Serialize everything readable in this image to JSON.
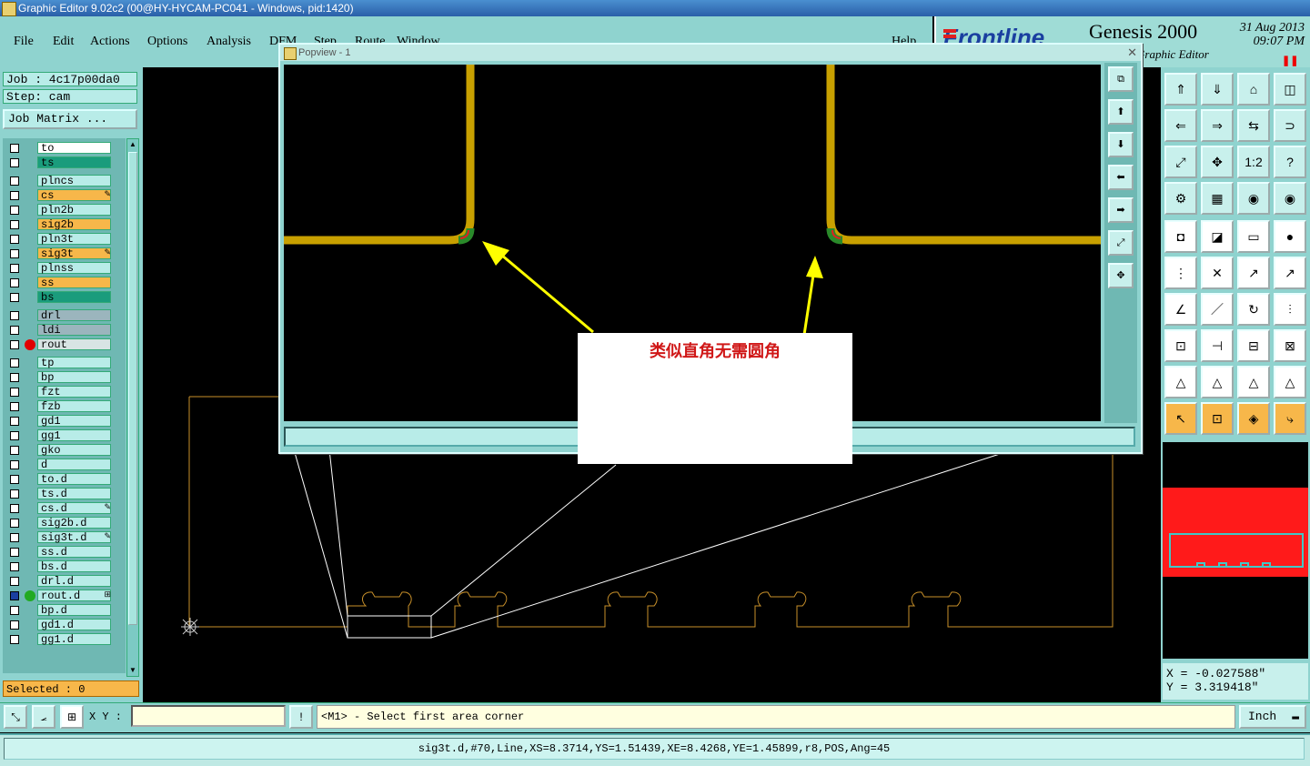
{
  "window": {
    "title": "Graphic Editor 9.02c2 (00@HY-HYCAM-PC041 - Windows, pid:1420)"
  },
  "menu": {
    "file": "File",
    "edit": "Edit",
    "actions": "Actions",
    "options": "Options",
    "analysis": "Analysis",
    "dfm": "DFM",
    "step": "Step",
    "route": "Route",
    "window": "Window",
    "help": "Help"
  },
  "brand": {
    "logo": "Frontline",
    "product": "Genesis 2000",
    "subtitle": "Graphic Editor",
    "date": "31 Aug 2013",
    "time": "09:07 PM"
  },
  "job": {
    "job_label": "Job : 4c17p00da0",
    "step_label": "Step: cam",
    "matrix_button": "Job Matrix ..."
  },
  "layers": [
    {
      "name": "to",
      "color": "#ffffff",
      "active": false,
      "mark": ""
    },
    {
      "name": "ts",
      "color": "#1a9c7c",
      "active": false,
      "mark": ""
    },
    {
      "name": "plncs",
      "color": "#b8ece8",
      "active": false,
      "mark": ""
    },
    {
      "name": "cs",
      "color": "#f7b74a",
      "active": false,
      "mark": "✎"
    },
    {
      "name": "pln2b",
      "color": "#b8ece8",
      "active": false,
      "mark": ""
    },
    {
      "name": "sig2b",
      "color": "#f7b74a",
      "active": false,
      "mark": ""
    },
    {
      "name": "pln3t",
      "color": "#b8ece8",
      "active": false,
      "mark": ""
    },
    {
      "name": "sig3t",
      "color": "#f7b74a",
      "active": false,
      "mark": "✎"
    },
    {
      "name": "plnss",
      "color": "#b8ece8",
      "active": false,
      "mark": ""
    },
    {
      "name": "ss",
      "color": "#f7b74a",
      "active": false,
      "mark": ""
    },
    {
      "name": "bs",
      "color": "#1a9c7c",
      "active": false,
      "mark": ""
    },
    {
      "name": "drl",
      "color": "#9bb5bd",
      "active": false,
      "mark": ""
    },
    {
      "name": "ldi",
      "color": "#9bb5bd",
      "active": false,
      "mark": ""
    },
    {
      "name": "rout",
      "color": "#d8e4e4",
      "active": false,
      "dot": "#e00000",
      "mark": ""
    },
    {
      "name": "tp",
      "color": "#b8ece8",
      "active": false,
      "mark": ""
    },
    {
      "name": "bp",
      "color": "#b8ece8",
      "active": false,
      "mark": ""
    },
    {
      "name": "fzt",
      "color": "#b8ece8",
      "active": false,
      "mark": ""
    },
    {
      "name": "fzb",
      "color": "#b8ece8",
      "active": false,
      "mark": ""
    },
    {
      "name": "gd1",
      "color": "#b8ece8",
      "active": false,
      "mark": ""
    },
    {
      "name": "gg1",
      "color": "#b8ece8",
      "active": false,
      "mark": ""
    },
    {
      "name": "gko",
      "color": "#b8ece8",
      "active": false,
      "mark": ""
    },
    {
      "name": "d",
      "color": "#b8ece8",
      "active": false,
      "mark": ""
    },
    {
      "name": "to.d",
      "color": "#b8ece8",
      "active": false,
      "mark": ""
    },
    {
      "name": "ts.d",
      "color": "#b8ece8",
      "active": false,
      "mark": ""
    },
    {
      "name": "cs.d",
      "color": "#b8ece8",
      "active": false,
      "mark": "✎"
    },
    {
      "name": "sig2b.d",
      "color": "#b8ece8",
      "active": false,
      "mark": ""
    },
    {
      "name": "sig3t.d",
      "color": "#b8ece8",
      "active": false,
      "mark": "✎"
    },
    {
      "name": "ss.d",
      "color": "#b8ece8",
      "active": false,
      "mark": ""
    },
    {
      "name": "bs.d",
      "color": "#b8ece8",
      "active": false,
      "mark": ""
    },
    {
      "name": "drl.d",
      "color": "#b8ece8",
      "active": false,
      "mark": ""
    },
    {
      "name": "rout.d",
      "color": "#b8ece8",
      "active": true,
      "dot": "#22aa22",
      "mark": "⊞"
    },
    {
      "name": "bp.d",
      "color": "#b8ece8",
      "active": false,
      "mark": ""
    },
    {
      "name": "gd1.d",
      "color": "#b8ece8",
      "active": false,
      "mark": ""
    },
    {
      "name": "gg1.d",
      "color": "#b8ece8",
      "active": false,
      "mark": ""
    }
  ],
  "selected": {
    "label": "Selected : 0"
  },
  "popview": {
    "title": "Popview - 1",
    "close": "✕"
  },
  "annotation": {
    "text": "类似直角无需圆角"
  },
  "coords": {
    "x": "X = -0.027588\"",
    "y": "Y = 3.319418\""
  },
  "command": {
    "xy_label": "X Y :",
    "xy_value": "",
    "prompt": "<M1> - Select first area corner",
    "units": "Inch"
  },
  "status": {
    "text": "sig3t.d,#70,Line,XS=8.3714,YS=1.51439,XE=8.4268,YE=1.45899,r8,POS,Ang=45"
  },
  "colors": {
    "panel": "#8fd3cf",
    "trace": "#c8a000",
    "outline": "#c8902a",
    "arrow": "#ffff00"
  },
  "toolbox": [
    "zoom-home-icon",
    "zoom-page-icon",
    "home-icon",
    "split-view-icon",
    "pan-left-icon",
    "pan-right-icon",
    "mirror-icon",
    "rotate-icon",
    "fit-icon",
    "center-icon",
    "scale-icon",
    "help-icon",
    "settings-icon",
    "grid-icon",
    "layer-red-icon",
    "layer-red2-icon",
    "add-feature-icon",
    "measure-angle-icon",
    "ruler-icon",
    "pad-icon",
    "connect-icon",
    "delete-icon",
    "move-icon",
    "copy-icon",
    "line-icon",
    "line2-icon",
    "arc-icon",
    "text-icon",
    "snap-icon",
    "break-icon",
    "dimension-icon",
    "shape-icon",
    "triangle-icon",
    "triangle2-icon",
    "triangle3-icon",
    "triangle4-icon",
    "select-icon",
    "select-box-icon",
    "select-area-icon",
    "route-icon"
  ]
}
